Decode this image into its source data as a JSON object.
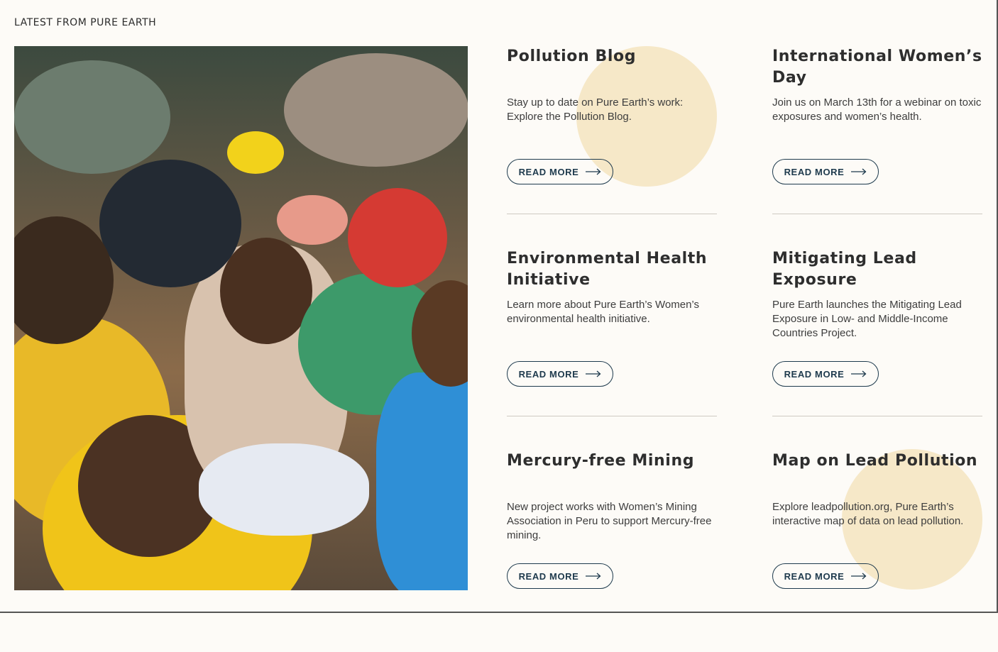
{
  "section_label": "LATEST FROM PURE EARTH",
  "cards": [
    {
      "title": "Pollution Blog",
      "description": "Stay up to date on Pure Earth’s work: Explore the Pollution Blog.",
      "button_label": "READ MORE"
    },
    {
      "title": "International Women’s Day",
      "description": "Join us on March 13th for a webinar on toxic exposures and women’s health.",
      "button_label": "READ MORE"
    },
    {
      "title": "Environmental Health Initiative",
      "description": "Learn more about Pure Earth’s Women’s environmental health initiative.",
      "button_label": "READ MORE"
    },
    {
      "title": "Mitigating Lead Exposure",
      "description": "Pure Earth launches the Mitigating Lead Exposure in Low- and Middle-Income Countries Project.",
      "button_label": "READ MORE"
    },
    {
      "title": "Mercury-free Mining",
      "description": "New project works with Women’s Mining Association in Peru to support Mercury-free mining.",
      "button_label": "READ MORE"
    },
    {
      "title": "Map on Lead Pollution",
      "description": "Explore leadpollution.org, Pure Earth’s interactive map of data on lead pollution.",
      "button_label": "READ MORE"
    }
  ],
  "colors": {
    "accent_circle": "#f6e8c8",
    "button_border": "#1e3a4d",
    "background": "#fdfbf7"
  }
}
